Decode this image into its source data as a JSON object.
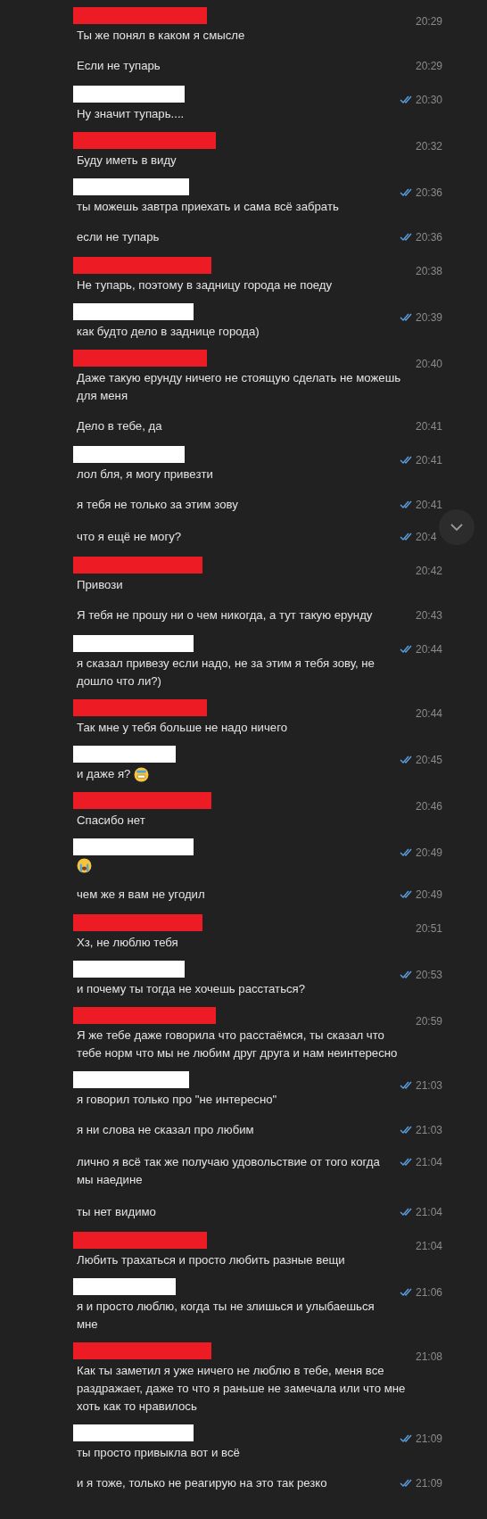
{
  "messages": [
    {
      "outgoing": false,
      "header": true,
      "text": "Ты же понял в каком я смысле",
      "time": "20:29"
    },
    {
      "header": false,
      "text": "Если не тупарь",
      "time": "20:29"
    },
    {
      "outgoing": true,
      "header": true,
      "text": "Ну значит тупарь....",
      "time": "20:30",
      "read": true
    },
    {
      "outgoing": false,
      "header": true,
      "text": "Буду иметь в виду",
      "time": "20:32"
    },
    {
      "outgoing": true,
      "header": true,
      "text": "ты можешь завтра приехать и сама всё забрать",
      "time": "20:36",
      "read": true
    },
    {
      "outgoing": true,
      "header": false,
      "text": "если не тупарь",
      "time": "20:36",
      "read": true
    },
    {
      "outgoing": false,
      "header": true,
      "text": "Не тупарь, поэтому в задницу города не поеду",
      "time": "20:38"
    },
    {
      "outgoing": true,
      "header": true,
      "text": "как будто дело в заднице города)",
      "time": "20:39",
      "read": true
    },
    {
      "outgoing": false,
      "header": true,
      "text": "Даже такую ерунду ничего не стоящую сделать не можешь для меня",
      "time": "20:40"
    },
    {
      "header": false,
      "text": "Дело в тебе, да",
      "time": "20:41"
    },
    {
      "outgoing": true,
      "header": true,
      "text": "лол бля, я могу привезти",
      "time": "20:41",
      "read": true
    },
    {
      "outgoing": true,
      "header": false,
      "text": "я тебя не только за этим зову",
      "time": "20:41",
      "read": true
    },
    {
      "outgoing": true,
      "header": false,
      "text": "что я ещё не могу?",
      "time": "20:4",
      "read": true
    },
    {
      "outgoing": false,
      "header": true,
      "text": "Привози",
      "time": "20:42"
    },
    {
      "header": false,
      "text": "Я тебя не прошу ни о чем никогда, а тут такую ерунду",
      "time": "20:43"
    },
    {
      "outgoing": true,
      "header": true,
      "text": "я сказал привезу если надо, не за этим я тебя зову, не дошло что ли?)",
      "time": "20:44",
      "read": true
    },
    {
      "outgoing": false,
      "header": true,
      "text": "Так мне у тебя больше не надо ничего",
      "time": "20:44"
    },
    {
      "outgoing": true,
      "header": true,
      "text": "и даже я?",
      "emoji": {
        "kind": "grimace"
      },
      "time": "20:45",
      "read": true
    },
    {
      "outgoing": false,
      "header": true,
      "text": "Спасибо нет",
      "time": "20:46"
    },
    {
      "outgoing": true,
      "header": true,
      "emoji": {
        "kind": "crying"
      },
      "time": "20:49",
      "read": true
    },
    {
      "outgoing": true,
      "header": false,
      "text": "чем же я вам не угодил",
      "time": "20:49",
      "read": true
    },
    {
      "outgoing": false,
      "header": true,
      "text": "Хз, не люблю тебя",
      "time": "20:51"
    },
    {
      "outgoing": true,
      "header": true,
      "text": "и почему ты тогда не хочешь расстаться?",
      "time": "20:53",
      "read": true
    },
    {
      "outgoing": false,
      "header": true,
      "text": "Я же тебе даже говорила что расстаёмся, ты сказал что тебе норм что мы не любим друг друга и нам неинтересно",
      "time": "20:59"
    },
    {
      "outgoing": true,
      "header": true,
      "text": "я говорил только про \"не интересно\"",
      "time": "21:03",
      "read": true
    },
    {
      "outgoing": true,
      "header": false,
      "text": "я ни слова не сказал про любим",
      "time": "21:03",
      "read": true
    },
    {
      "outgoing": true,
      "header": false,
      "text": "лично я всё так же получаю удовольствие от того когда мы наедине",
      "time": "21:04",
      "read": true
    },
    {
      "outgoing": true,
      "header": false,
      "text": "ты нет видимо",
      "time": "21:04",
      "read": true
    },
    {
      "outgoing": false,
      "header": true,
      "text": "Любить трахаться и просто любить разные вещи",
      "time": "21:04"
    },
    {
      "outgoing": true,
      "header": true,
      "text": "я и просто люблю, когда ты не злишься и улыбаешься мне",
      "time": "21:06",
      "read": true
    },
    {
      "outgoing": false,
      "header": true,
      "text": "Как ты заметил я уже ничего не люблю в тебе, меня все раздражает, даже то что я раньше не замечала или что мне хоть как то нравилось",
      "time": "21:08"
    },
    {
      "outgoing": true,
      "header": true,
      "text": "ты просто привыкла вот и всё",
      "time": "21:09",
      "read": true
    },
    {
      "outgoing": true,
      "header": false,
      "text": "и я тоже, только не реагирую на это так резко",
      "time": "21:09",
      "read": true
    }
  ],
  "scroll_down_button": {
    "visible": true
  }
}
